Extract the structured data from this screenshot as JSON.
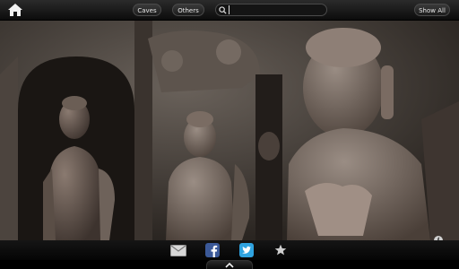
{
  "header": {
    "tabs": [
      {
        "label": "Caves"
      },
      {
        "label": "Others"
      }
    ],
    "search": {
      "value": "",
      "placeholder": ""
    },
    "show_all_label": "Show All"
  },
  "icons": {
    "home": "home-icon",
    "search": "search-icon",
    "email": "email-icon",
    "facebook": "facebook-icon",
    "twitter": "twitter-icon",
    "favorite": "star-icon",
    "info": "info-icon",
    "expand": "chevron-up-icon"
  },
  "info_label": "i",
  "colors": {
    "facebook": "#3b5998",
    "twitter": "#2fa3e0"
  }
}
